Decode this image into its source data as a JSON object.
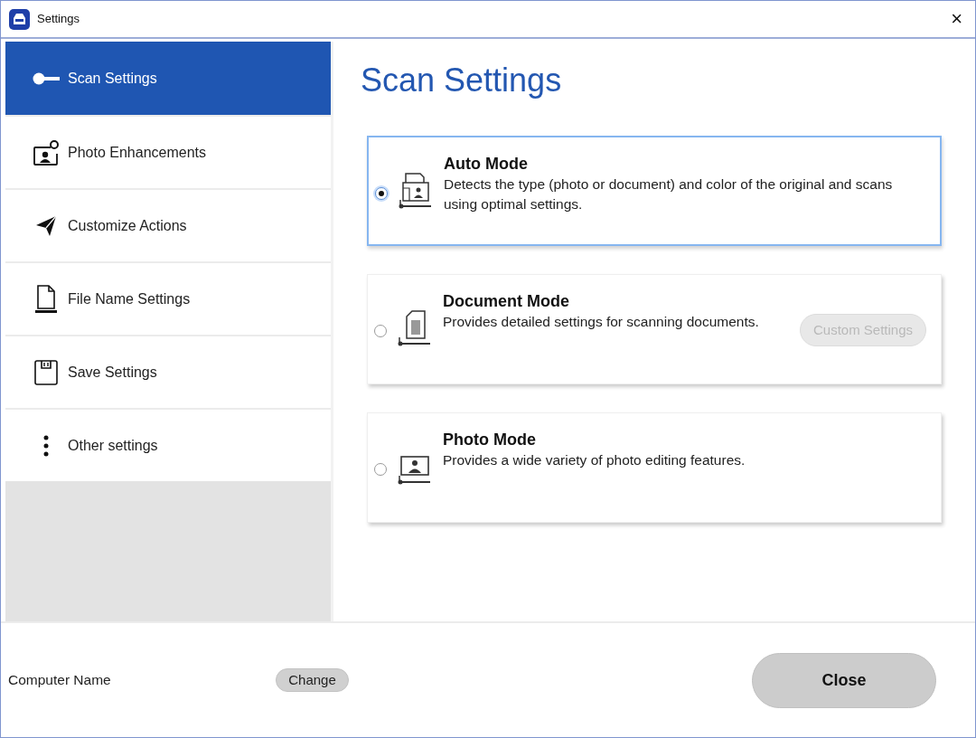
{
  "window": {
    "title": "Settings",
    "close": "×"
  },
  "sidebar": {
    "items": [
      {
        "label": "Scan Settings",
        "selected": true
      },
      {
        "label": "Photo Enhancements",
        "selected": false
      },
      {
        "label": "Customize Actions",
        "selected": false
      },
      {
        "label": "File Name Settings",
        "selected": false
      },
      {
        "label": "Save Settings",
        "selected": false
      },
      {
        "label": "Other settings",
        "selected": false
      }
    ]
  },
  "main": {
    "heading": "Scan Settings",
    "modes": [
      {
        "title": "Auto Mode",
        "description": "Detects the type (photo or document) and color of the original and scans using optimal settings.",
        "selected": true
      },
      {
        "title": "Document Mode",
        "description": "Provides detailed settings for scanning documents.",
        "selected": false,
        "button": {
          "label": "Custom Settings",
          "disabled": true
        }
      },
      {
        "title": "Photo Mode",
        "description": "Provides a wide variety of photo editing features.",
        "selected": false
      }
    ]
  },
  "footer": {
    "computer_name_label": "Computer Name",
    "change_button": "Change",
    "close_button": "Close"
  }
}
